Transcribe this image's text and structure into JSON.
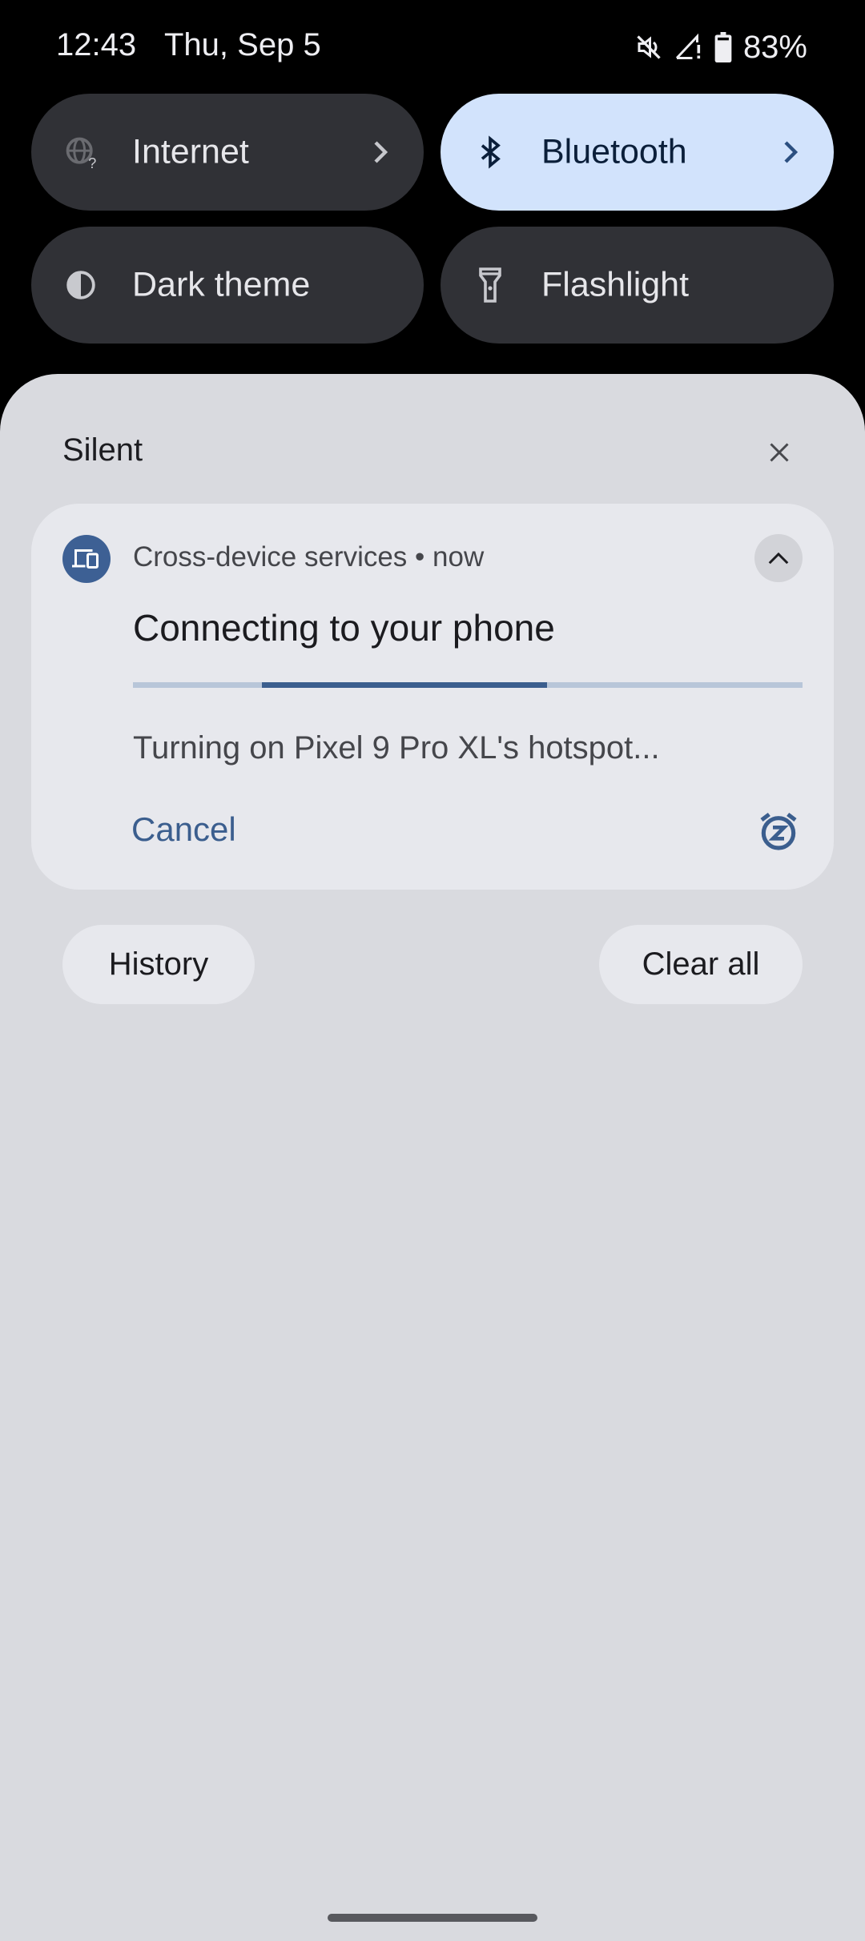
{
  "status_bar": {
    "time": "12:43",
    "date": "Thu, Sep 5",
    "icons": [
      "mute-icon",
      "signal-no-service-icon",
      "battery-icon"
    ],
    "battery_percent": "83%"
  },
  "quick_tiles": [
    {
      "label": "Internet",
      "icon": "globe-unknown-icon",
      "active": false,
      "has_chevron": true
    },
    {
      "label": "Bluetooth",
      "icon": "bluetooth-icon",
      "active": true,
      "has_chevron": true
    },
    {
      "label": "Dark theme",
      "icon": "contrast-icon",
      "active": false,
      "has_chevron": false
    },
    {
      "label": "Flashlight",
      "icon": "flashlight-icon",
      "active": false,
      "has_chevron": false
    }
  ],
  "notifications": {
    "section_title": "Silent",
    "items": [
      {
        "app_icon": "devices-icon",
        "app_name": "Cross-device services",
        "separator": "•",
        "time": "now",
        "meta": "Cross-device services • now",
        "title": "Connecting to your phone",
        "progress": {
          "indeterminate": true
        },
        "text": "Turning on Pixel 9 Pro XL's hotspot...",
        "actions": [
          {
            "label": "Cancel"
          }
        ],
        "snooze_icon": "snooze-icon",
        "expanded": true
      }
    ],
    "history_label": "History",
    "clear_all_label": "Clear all"
  },
  "colors": {
    "accent": "#3b5e8e",
    "tile_active_bg": "#d2e3fc",
    "tile_inactive_bg": "#303136",
    "shade_bg": "#d9dadf",
    "card_bg": "#e7e8ed"
  }
}
